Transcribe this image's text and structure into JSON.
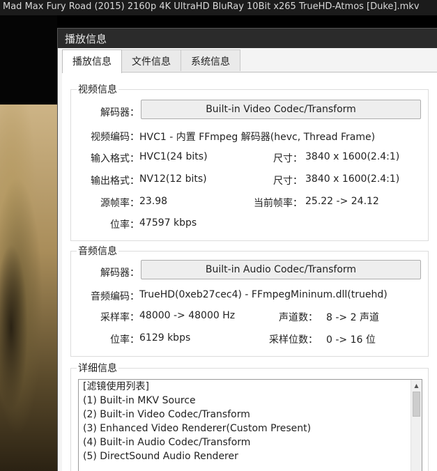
{
  "player": {
    "title": "Mad Max Fury Road (2015) 2160p 4K UltraHD BluRay 10Bit x265 TrueHD-Atmos [Duke].mkv"
  },
  "dialog": {
    "title": "播放信息",
    "tabs": [
      {
        "label": "播放信息",
        "active": true
      },
      {
        "label": "文件信息",
        "active": false
      },
      {
        "label": "系统信息",
        "active": false
      }
    ]
  },
  "video": {
    "group_title": "视频信息",
    "decoder_label": "解码器：",
    "decoder_value": "Built-in Video Codec/Transform",
    "codec_label": "视频编码：",
    "codec_value": "HVC1 - 内置 FFmpeg 解码器(hevc, Thread Frame)",
    "input_label": "输入格式：",
    "input_value": "HVC1(24 bits)",
    "input_size_label": "尺寸：",
    "input_size_value": "3840 x 1600(2.4:1)",
    "output_label": "输出格式：",
    "output_value": "NV12(12 bits)",
    "output_size_label": "尺寸：",
    "output_size_value": "3840 x 1600(2.4:1)",
    "src_fps_label": "源帧率：",
    "src_fps_value": "23.98",
    "cur_fps_label": "当前帧率：",
    "cur_fps_value": "25.22 -> 24.12",
    "bitrate_label": "位率：",
    "bitrate_value": "47597 kbps"
  },
  "audio": {
    "group_title": "音频信息",
    "decoder_label": "解码器：",
    "decoder_value": "Built-in Audio Codec/Transform",
    "codec_label": "音频编码：",
    "codec_value": "TrueHD(0xeb27cec4) - FFmpegMininum.dll(truehd)",
    "samplerate_label": "采样率：",
    "samplerate_value": "48000 -> 48000 Hz",
    "channels_label": "声道数：",
    "channels_value": "8 -> 2 声道",
    "bitrate_label": "位率：",
    "bitrate_value": "6129 kbps",
    "bits_label": "采样位数：",
    "bits_value": "0 -> 16 位"
  },
  "details": {
    "group_title": "详细信息",
    "items": [
      "[滤镜使用列表]",
      "(1) Built-in MKV Source",
      "(2) Built-in Video Codec/Transform",
      "(3) Enhanced Video Renderer(Custom Present)",
      "(4) Built-in Audio Codec/Transform",
      "(5) DirectSound Audio Renderer"
    ]
  },
  "colors": {
    "titlebar": "#2b2b2b",
    "panel": "#ffffff",
    "button": "#eeeeee"
  }
}
